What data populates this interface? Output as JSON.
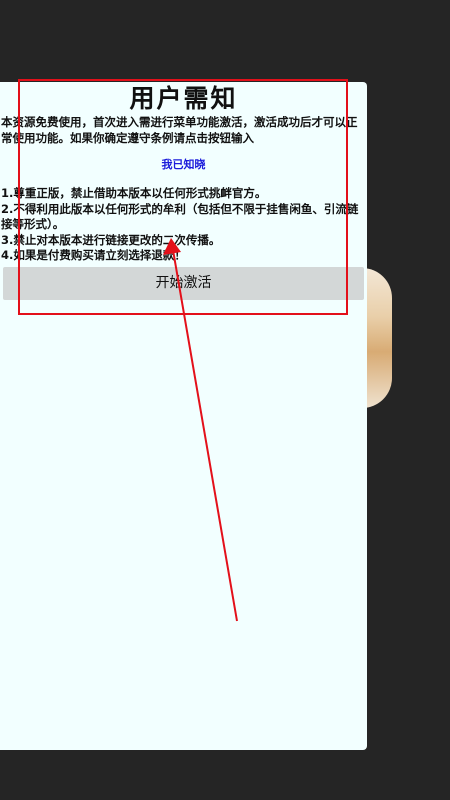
{
  "dialog": {
    "title": "用户需知",
    "intro": "本资源免费使用，首次进入需进行菜单功能激活，激活成功后才可以正常使用功能。如果你确定遵守条例请点击按钮输入",
    "ack_label": "我已知晓",
    "rules": [
      "1.尊重正版，禁止借助本版本以任何形式挑衅官方。",
      "2.不得利用此版本以任何形式的牟利（包括但不限于挂售闲鱼、引流链接等形式）。",
      "3.禁止对本版本进行链接更改的二次传播。",
      "4.如果是付费购买请立刻选择退款！"
    ],
    "start_button_label": "开始激活"
  },
  "colors": {
    "background": "#252525",
    "dialog_background": "#f2ffff",
    "ack_text": "#1a1adb",
    "button_background": "#d3d7d7",
    "annotation": "#e3101a"
  }
}
